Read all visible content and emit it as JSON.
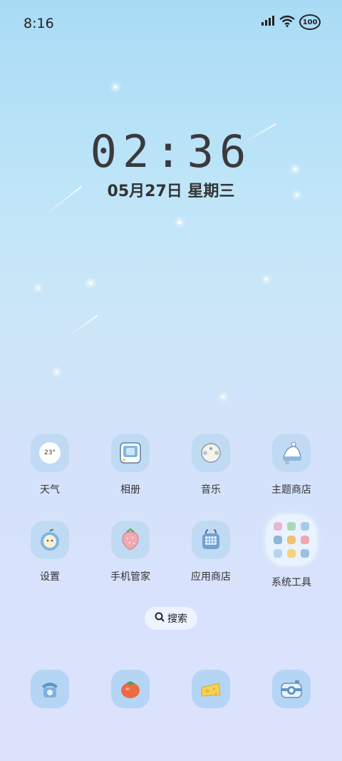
{
  "status_bar": {
    "time": "8:16",
    "battery": "100",
    "icons": [
      "signal-icon",
      "wifi-icon",
      "battery-icon"
    ]
  },
  "clock": {
    "time": "02:36",
    "date": "05月27日 星期三"
  },
  "apps": {
    "row1": [
      {
        "label": "天气",
        "icon": "weather-icon",
        "icon_text": "23°"
      },
      {
        "label": "相册",
        "icon": "gallery-icon"
      },
      {
        "label": "音乐",
        "icon": "music-icon"
      },
      {
        "label": "主题商店",
        "icon": "theme-store-icon"
      }
    ],
    "row2": [
      {
        "label": "设置",
        "icon": "settings-icon"
      },
      {
        "label": "手机管家",
        "icon": "phone-manager-icon"
      },
      {
        "label": "应用商店",
        "icon": "app-store-icon"
      },
      {
        "label": "系统工具",
        "icon": "system-tools-folder-icon"
      }
    ]
  },
  "search": {
    "label": "搜索"
  },
  "dock": [
    "phone-icon",
    "tomato-icon",
    "cheese-icon",
    "camera-icon"
  ],
  "colors": {
    "background_top": "#a9dbf6",
    "background_bottom": "#dde2fc",
    "icon_tile": "#b9d7f0"
  }
}
